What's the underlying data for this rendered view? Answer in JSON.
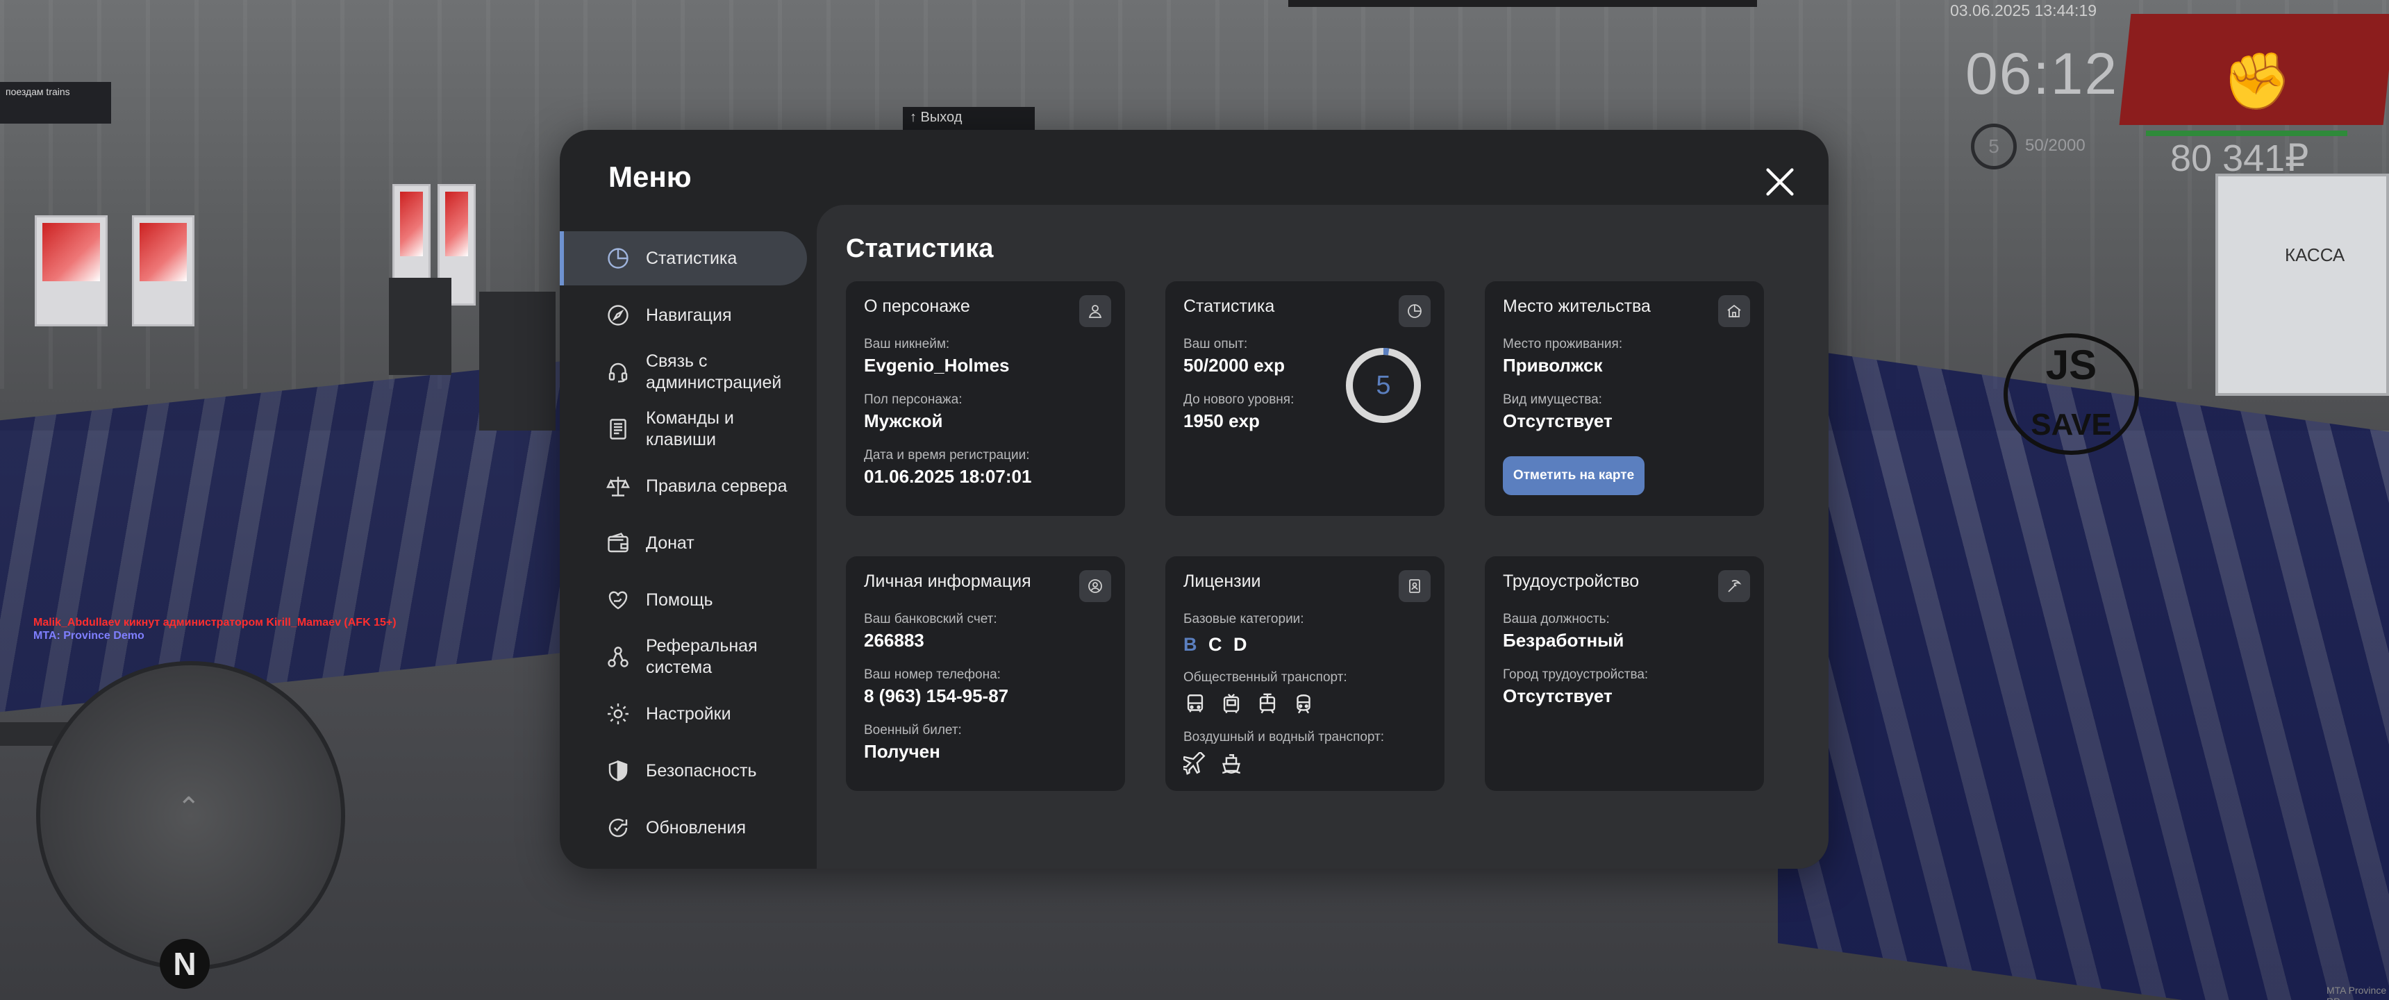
{
  "hud": {
    "datetime": "03.06.2025 13:44:19",
    "time": "06:12",
    "level": "5",
    "exp": "50/2000",
    "money": "80 341₽"
  },
  "background": {
    "station_sign": "поездам trains",
    "exit_sign": "↑ Выход",
    "kassa": "КАССА",
    "save_logo": "SAVE",
    "corner_tag": "MTA Province RP"
  },
  "chat": {
    "line1": "Malik_Abdullaev кикнут администратором Kirill_Mamaev (AFK 15+)",
    "line2": "MTA: Province Demo"
  },
  "minimap": {
    "north": "N"
  },
  "menu": {
    "title": "Меню",
    "nav": [
      {
        "label": "Статистика",
        "icon": "pie-chart-icon"
      },
      {
        "label": "Навигация",
        "icon": "compass-icon"
      },
      {
        "label": "Связь с администрацией",
        "icon": "headset-icon"
      },
      {
        "label": "Команды и клавиши",
        "icon": "keyboard-icon"
      },
      {
        "label": "Правила сервера",
        "icon": "scales-icon"
      },
      {
        "label": "Донат",
        "icon": "wallet-icon"
      },
      {
        "label": "Помощь",
        "icon": "heart-hand-icon"
      },
      {
        "label": "Реферальная система",
        "icon": "referral-icon"
      },
      {
        "label": "Настройки",
        "icon": "gear-icon"
      },
      {
        "label": "Безопасность",
        "icon": "shield-icon"
      },
      {
        "label": "Обновления",
        "icon": "update-icon"
      }
    ]
  },
  "stats": {
    "title": "Статистика",
    "character": {
      "title": "О персонаже",
      "nick_label": "Ваш никнейм:",
      "nick": "Evgenio_Holmes",
      "gender_label": "Пол персонажа:",
      "gender": "Мужской",
      "reg_label": "Дата и время регистрации:",
      "reg": "01.06.2025 18:07:01"
    },
    "statistics": {
      "title": "Статистика",
      "exp_label": "Ваш опыт:",
      "exp": "50/2000 exp",
      "next_label": "До нового уровня:",
      "next": "1950 exp",
      "level": "5",
      "progress": 0.025
    },
    "residence": {
      "title": "Место жительства",
      "place_label": "Место проживания:",
      "place": "Приволжск",
      "property_label": "Вид имущества:",
      "property": "Отсутствует",
      "map_button": "Отметить на карте"
    },
    "personal": {
      "title": "Личная информация",
      "bank_label": "Ваш банковский счет:",
      "bank": "266883",
      "phone_label": "Ваш номер телефона:",
      "phone": "8 (963) 154-95-87",
      "military_label": "Военный билет:",
      "military": "Получен"
    },
    "licenses": {
      "title": "Лицензии",
      "base_label": "Базовые категории:",
      "categories": [
        "B",
        "C",
        "D"
      ],
      "public_label": "Общественный транспорт:",
      "air_label": "Воздушный и водный транспорт:"
    },
    "employment": {
      "title": "Трудоустройство",
      "position_label": "Ваша должность:",
      "position": "Безработный",
      "city_label": "Город трудоустройства:",
      "city": "Отсутствует"
    }
  },
  "colors": {
    "accent": "#5b7fbf",
    "card_bg": "#1f2023",
    "panel_bg": "#2f3033",
    "modal_bg": "#232426"
  }
}
